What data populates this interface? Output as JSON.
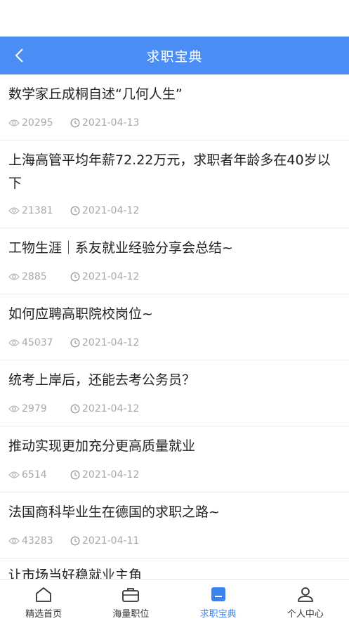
{
  "header": {
    "title": "求职宝典",
    "back_icon": "chevron-left-icon"
  },
  "articles": [
    {
      "title": "数学家丘成桐自述“几何人生”",
      "views": "20295",
      "date": "2021-04-13"
    },
    {
      "title": "上海高管平均年薪72.22万元，求职者年龄多在40岁以下",
      "views": "21381",
      "date": "2021-04-12"
    },
    {
      "title": "工物生涯｜系友就业经验分享会总结~",
      "views": "2885",
      "date": "2021-04-12"
    },
    {
      "title": "如何应聘高职院校岗位~",
      "views": "45037",
      "date": "2021-04-12"
    },
    {
      "title": "统考上岸后，还能去考公务员？",
      "views": "2979",
      "date": "2021-04-12"
    },
    {
      "title": "推动实现更加充分更高质量就业",
      "views": "6514",
      "date": "2021-04-12"
    },
    {
      "title": "法国商科毕业生在德国的求职之路~",
      "views": "43283",
      "date": "2021-04-11"
    },
    {
      "title": "让市场当好稳就业主角",
      "views": "",
      "date": ""
    }
  ],
  "tabs": [
    {
      "label": "精选首页",
      "icon": "home-icon",
      "active": false
    },
    {
      "label": "海量职位",
      "icon": "briefcase-icon",
      "active": false
    },
    {
      "label": "求职宝典",
      "icon": "document-icon",
      "active": true
    },
    {
      "label": "个人中心",
      "icon": "user-icon",
      "active": false
    }
  ],
  "colors": {
    "primary": "#4a8ef5",
    "tab_active": "#3a84f0",
    "meta_text": "#a8a8a8"
  }
}
